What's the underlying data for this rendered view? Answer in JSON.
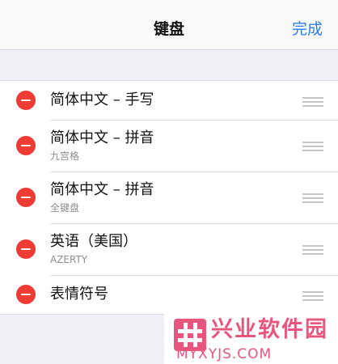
{
  "navbar": {
    "title": "键盘",
    "done_label": "完成"
  },
  "keyboards": [
    {
      "title": "简体中文 – 手写",
      "subtitle": ""
    },
    {
      "title": "简体中文 – 拼音",
      "subtitle": "九宫格"
    },
    {
      "title": "简体中文 – 拼音",
      "subtitle": "全键盘"
    },
    {
      "title": "英语（美国）",
      "subtitle": "AZERTY"
    },
    {
      "title": "表情符号",
      "subtitle": ""
    }
  ],
  "watermark": {
    "name": "兴业软件园",
    "domain": "MYXYJS.COM"
  },
  "colors": {
    "accent": "#2a7ee3",
    "delete": "#ec3c34",
    "watermark": "#e8557d",
    "background": "#efeff4"
  },
  "icons": {
    "delete": "minus-circle-icon",
    "reorder": "reorder-handle-icon",
    "logo": "hash-logo-icon"
  }
}
